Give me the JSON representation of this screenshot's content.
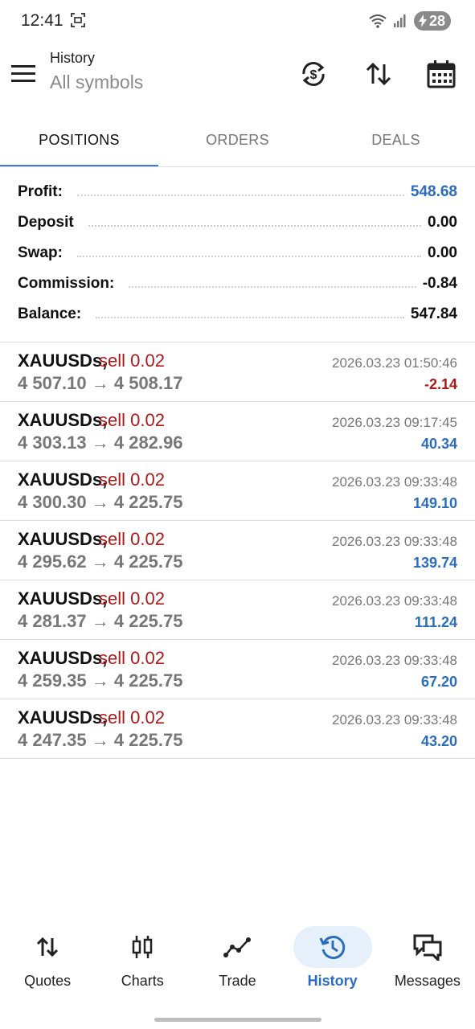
{
  "status_bar": {
    "time": "12:41",
    "battery": "28"
  },
  "app_bar": {
    "title": "History",
    "subtitle": "All symbols"
  },
  "tabs": [
    {
      "label": "POSITIONS",
      "active": true
    },
    {
      "label": "ORDERS",
      "active": false
    },
    {
      "label": "DEALS",
      "active": false
    }
  ],
  "summary": {
    "profit": {
      "label": "Profit:",
      "value": "548.68"
    },
    "deposit": {
      "label": "Deposit",
      "value": "0.00"
    },
    "swap": {
      "label": "Swap:",
      "value": "0.00"
    },
    "commission": {
      "label": "Commission:",
      "value": "-0.84"
    },
    "balance": {
      "label": "Balance:",
      "value": "547.84"
    }
  },
  "positions": [
    {
      "symbol": "XAUUSDs,",
      "side": "sell 0.02",
      "prices": "4 507.10 → 4 508.17",
      "time": "2026.03.23 01:50:46",
      "profit": "-2.14"
    },
    {
      "symbol": "XAUUSDs,",
      "side": "sell 0.02",
      "prices": "4 303.13 → 4 282.96",
      "time": "2026.03.23 09:17:45",
      "profit": "40.34"
    },
    {
      "symbol": "XAUUSDs,",
      "side": "sell 0.02",
      "prices": "4 300.30 → 4 225.75",
      "time": "2026.03.23 09:33:48",
      "profit": "149.10"
    },
    {
      "symbol": "XAUUSDs,",
      "side": "sell 0.02",
      "prices": "4 295.62 → 4 225.75",
      "time": "2026.03.23 09:33:48",
      "profit": "139.74"
    },
    {
      "symbol": "XAUUSDs,",
      "side": "sell 0.02",
      "prices": "4 281.37 → 4 225.75",
      "time": "2026.03.23 09:33:48",
      "profit": "111.24"
    },
    {
      "symbol": "XAUUSDs,",
      "side": "sell 0.02",
      "prices": "4 259.35 → 4 225.75",
      "time": "2026.03.23 09:33:48",
      "profit": "67.20"
    },
    {
      "symbol": "XAUUSDs,",
      "side": "sell 0.02",
      "prices": "4 247.35 → 4 225.75",
      "time": "2026.03.23 09:33:48",
      "profit": "43.20"
    }
  ],
  "bottom_nav": [
    {
      "label": "Quotes",
      "icon": "quotes-icon",
      "active": false
    },
    {
      "label": "Charts",
      "icon": "charts-icon",
      "active": false
    },
    {
      "label": "Trade",
      "icon": "trade-icon",
      "active": false
    },
    {
      "label": "History",
      "icon": "history-icon",
      "active": true
    },
    {
      "label": "Messages",
      "icon": "messages-icon",
      "active": false
    }
  ],
  "colors": {
    "accent": "#2a6cc0",
    "loss": "#b01818",
    "sell": "#b01818"
  }
}
